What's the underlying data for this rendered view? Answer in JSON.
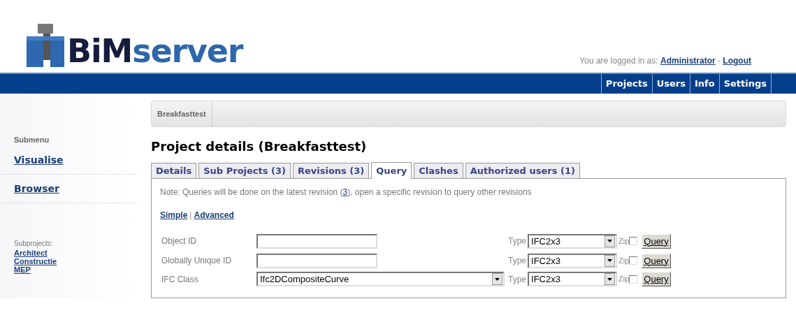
{
  "logo": {
    "bold": "BiM",
    "light": "server"
  },
  "login": {
    "prefix": "You are logged in as:",
    "user": "Administrator",
    "separator": "-",
    "logout": "Logout"
  },
  "nav": [
    "Projects",
    "Users",
    "Info",
    "Settings"
  ],
  "sidebar": {
    "heading": "Submenu",
    "items": [
      "Visualise",
      "Browser"
    ],
    "subprojects_label": "Subprojects:",
    "subprojects": [
      "Architect",
      "Constructie",
      "MEP"
    ]
  },
  "breadcrumb": [
    "Breakfasttest"
  ],
  "title": "Project details (Breakfasttest)",
  "tabs": [
    {
      "label": "Details",
      "selected": false
    },
    {
      "label": "Sub Projects (3)",
      "selected": false
    },
    {
      "label": "Revisions (3)",
      "selected": false
    },
    {
      "label": "Query",
      "selected": true
    },
    {
      "label": "Clashes",
      "selected": false
    },
    {
      "label": "Authorized users (1)",
      "selected": false
    }
  ],
  "note": {
    "before": "Note: Queries will be done on the latest revision (",
    "link": "3",
    "after": "), open a specific revision to query other revisions"
  },
  "modes": {
    "items": [
      "Simple",
      "Advanced"
    ],
    "separator": "|"
  },
  "rows": [
    {
      "label": "Object ID",
      "kind": "text",
      "value": "",
      "type_label": "Type",
      "type": "IFC2x3",
      "zip_label": "Zip",
      "zip": false,
      "button": "Query"
    },
    {
      "label": "Globally Unique ID",
      "kind": "text",
      "value": "",
      "type_label": "Type",
      "type": "IFC2x3",
      "zip_label": "Zip",
      "zip": false,
      "button": "Query"
    },
    {
      "label": "IFC Class",
      "kind": "select",
      "value": "Ifc2DCompositeCurve",
      "type_label": "Type",
      "type": "IFC2x3",
      "zip_label": "Zip",
      "zip": false,
      "button": "Query"
    }
  ]
}
